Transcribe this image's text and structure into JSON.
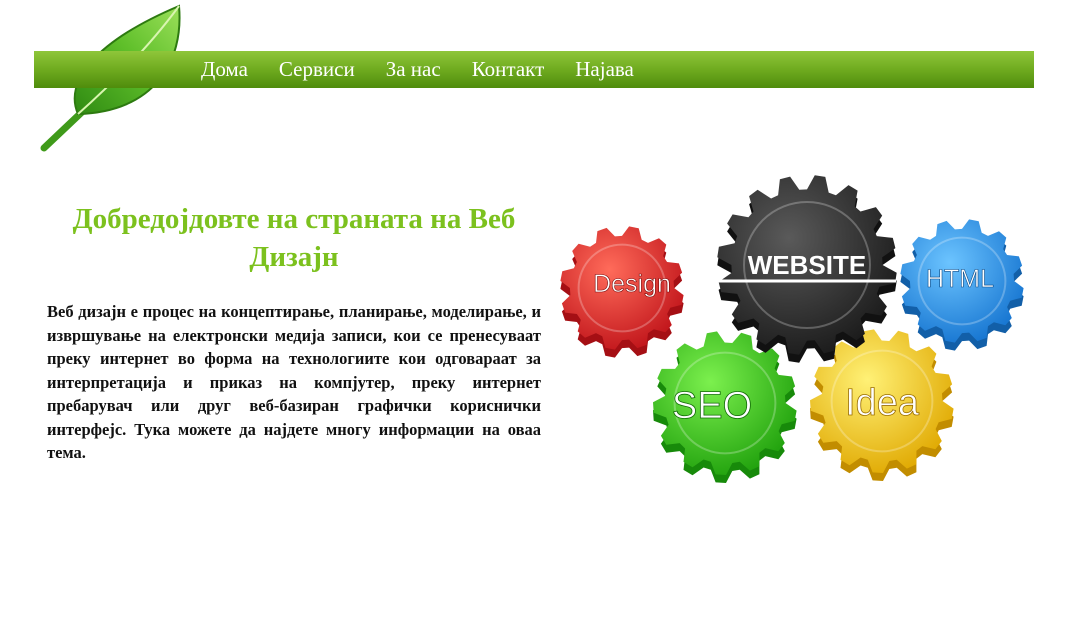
{
  "nav": {
    "items": [
      "Дома",
      "Сервиси",
      "За нас",
      "Контакт",
      "Најава"
    ]
  },
  "main": {
    "title": "Добредојдовте на страната на Веб Дизајн",
    "text": "Веб дизајн е процес на концептирање, планирање, моделирање, и извршување на електронски медија записи, кои се пренесуваат преку интернет во форма на технологиите кои одговараат за интерпретација и приказ на компјутер, преку интернет пребарувач или друг веб-базиран графички кориснички интерфејс. Тука можете да најдете многу информации на оваа тема."
  },
  "image": {
    "gears": {
      "website": "WEBSITE",
      "design": "Design",
      "html": "HTML",
      "seo": "SEO",
      "idea": "Idea"
    }
  },
  "colors": {
    "nav_bar": "#6fab1f",
    "title": "#7cc11e",
    "gear_website": "#2d2d2d",
    "gear_design": "#e8282a",
    "gear_html": "#2b93e8",
    "gear_seo": "#3fcf1e",
    "gear_idea": "#f3d21a"
  }
}
